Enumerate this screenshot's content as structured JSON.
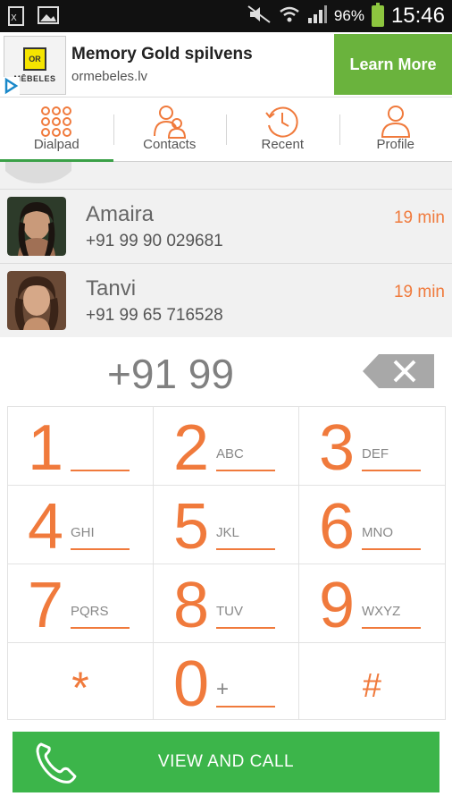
{
  "status_bar": {
    "battery_pct": "96%",
    "time": "15:46",
    "accent": "#8dc63f"
  },
  "ad": {
    "logo_text": "MĒBELES",
    "logo_box": "OR",
    "title": "Memory Gold spilvens",
    "url": "ormebeles.lv",
    "cta": "Learn More",
    "cta_color": "#6ab33d"
  },
  "tabs": [
    {
      "label": "Dialpad",
      "icon": "dialpad-icon",
      "active": true
    },
    {
      "label": "Contacts",
      "icon": "contacts-icon",
      "active": false
    },
    {
      "label": "Recent",
      "icon": "recent-icon",
      "active": false
    },
    {
      "label": "Profile",
      "icon": "profile-icon",
      "active": false
    }
  ],
  "recent": [
    {
      "name": "Amaira",
      "number": "+91 99 90 029681",
      "time": "19 min"
    },
    {
      "name": "Tanvi",
      "number": "+91 99 65 716528",
      "time": "19 min"
    }
  ],
  "dial": {
    "typed": "+91 99"
  },
  "keypad": {
    "keys": [
      {
        "digit": "1",
        "letters": ""
      },
      {
        "digit": "2",
        "letters": "ABC"
      },
      {
        "digit": "3",
        "letters": "DEF"
      },
      {
        "digit": "4",
        "letters": "GHI"
      },
      {
        "digit": "5",
        "letters": "JKL"
      },
      {
        "digit": "6",
        "letters": "MNO"
      },
      {
        "digit": "7",
        "letters": "PQRS"
      },
      {
        "digit": "8",
        "letters": "TUV"
      },
      {
        "digit": "9",
        "letters": "WXYZ"
      },
      {
        "digit": "*",
        "letters": ""
      },
      {
        "digit": "0",
        "letters": "+"
      },
      {
        "digit": "#",
        "letters": ""
      }
    ],
    "accent": "#f07a3c"
  },
  "call_button": {
    "label": "VIEW AND CALL",
    "color": "#3cb54a"
  }
}
